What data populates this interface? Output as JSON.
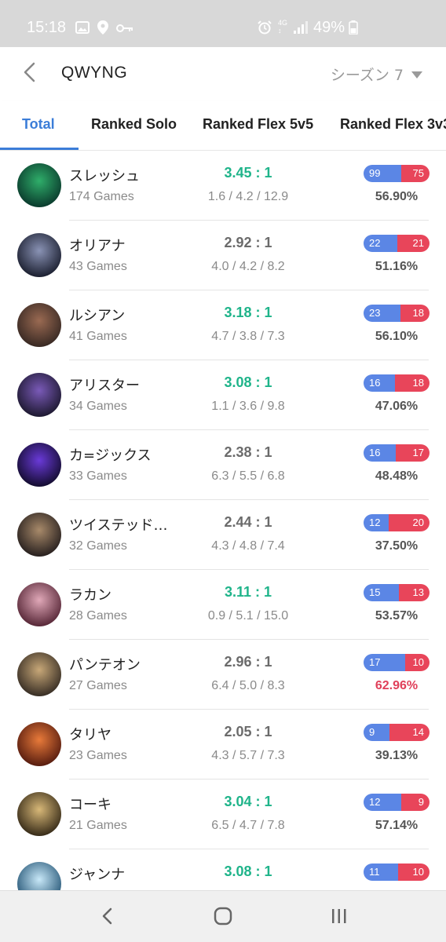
{
  "status_bar": {
    "time": "15:18",
    "battery_percent": "49%",
    "icons_left": [
      "image-icon",
      "location-icon",
      "key-icon"
    ],
    "icons_right": [
      "alarm-icon",
      "4g-signal-icon",
      "signal-icon",
      "battery-icon"
    ]
  },
  "header": {
    "title": "QWYNG",
    "season_label": "シーズン 7"
  },
  "tabs": [
    {
      "label": "Total",
      "active": true
    },
    {
      "label": "Ranked Solo",
      "active": false
    },
    {
      "label": "Ranked Flex 5v5",
      "active": false
    },
    {
      "label": "Ranked Flex 3v3",
      "active": false
    }
  ],
  "colors": {
    "accent": "#3b7dd8",
    "kda_good": "#1fb48a",
    "win": "#5b86e5",
    "loss": "#e8455a",
    "winrate_high": "#e0405a"
  },
  "champions": [
    {
      "name": "スレッシュ",
      "games": "174 Games",
      "kda": "3.45 : 1",
      "kda_good": true,
      "kda_detail": "1.6 / 4.2 / 12.9",
      "wins": "99",
      "losses": "75",
      "winrate": "56.90%",
      "winrate_high": false,
      "avatar_colors": [
        "#0b3d2e",
        "#2fae6a"
      ]
    },
    {
      "name": "オリアナ",
      "games": "43 Games",
      "kda": "2.92 : 1",
      "kda_good": false,
      "kda_detail": "4.0 / 4.2 / 8.2",
      "wins": "22",
      "losses": "21",
      "winrate": "51.16%",
      "winrate_high": false,
      "avatar_colors": [
        "#1e2233",
        "#8a93b5"
      ]
    },
    {
      "name": "ルシアン",
      "games": "41 Games",
      "kda": "3.18 : 1",
      "kda_good": true,
      "kda_detail": "4.7 / 3.8 / 7.3",
      "wins": "23",
      "losses": "18",
      "winrate": "56.10%",
      "winrate_high": false,
      "avatar_colors": [
        "#3a2a24",
        "#9a6a52"
      ]
    },
    {
      "name": "アリスター",
      "games": "34 Games",
      "kda": "3.08 : 1",
      "kda_good": true,
      "kda_detail": "1.1 / 3.6 / 9.8",
      "wins": "16",
      "losses": "18",
      "winrate": "47.06%",
      "winrate_high": false,
      "avatar_colors": [
        "#1f1a33",
        "#7a5ab8"
      ]
    },
    {
      "name": "カ=ジックス",
      "games": "33 Games",
      "kda": "2.38 : 1",
      "kda_good": false,
      "kda_detail": "6.3 / 5.5 / 6.8",
      "wins": "16",
      "losses": "17",
      "winrate": "48.48%",
      "winrate_high": false,
      "avatar_colors": [
        "#150d33",
        "#6a3ad8"
      ]
    },
    {
      "name": "ツイステッド…",
      "games": "32 Games",
      "kda": "2.44 : 1",
      "kda_good": false,
      "kda_detail": "4.3 / 4.8 / 7.4",
      "wins": "12",
      "losses": "20",
      "winrate": "37.50%",
      "winrate_high": false,
      "avatar_colors": [
        "#2a2220",
        "#a88a6a"
      ]
    },
    {
      "name": "ラカン",
      "games": "28 Games",
      "kda": "3.11 : 1",
      "kda_good": true,
      "kda_detail": "0.9 / 5.1 / 15.0",
      "wins": "15",
      "losses": "13",
      "winrate": "53.57%",
      "winrate_high": false,
      "avatar_colors": [
        "#5a2a3a",
        "#e0a8b8"
      ]
    },
    {
      "name": "パンテオン",
      "games": "27 Games",
      "kda": "2.96 : 1",
      "kda_good": false,
      "kda_detail": "6.4 / 5.0 / 8.3",
      "wins": "17",
      "losses": "10",
      "winrate": "62.96%",
      "winrate_high": true,
      "avatar_colors": [
        "#3a3026",
        "#c8a878"
      ]
    },
    {
      "name": "タリヤ",
      "games": "23 Games",
      "kda": "2.05 : 1",
      "kda_good": false,
      "kda_detail": "4.3 / 5.7 / 7.3",
      "wins": "9",
      "losses": "14",
      "winrate": "39.13%",
      "winrate_high": false,
      "avatar_colors": [
        "#5a1e10",
        "#e87a3a"
      ]
    },
    {
      "name": "コーキ",
      "games": "21 Games",
      "kda": "3.04 : 1",
      "kda_good": true,
      "kda_detail": "6.5 / 4.7 / 7.8",
      "wins": "12",
      "losses": "9",
      "winrate": "57.14%",
      "winrate_high": false,
      "avatar_colors": [
        "#3a2e1a",
        "#d8b878"
      ]
    },
    {
      "name": "ジャンナ",
      "games": "",
      "kda": "3.08 : 1",
      "kda_good": true,
      "kda_detail": "",
      "wins": "11",
      "losses": "10",
      "winrate": "",
      "winrate_high": false,
      "avatar_colors": [
        "#2a5a7a",
        "#c8e8f8"
      ]
    }
  ],
  "nav": {
    "buttons": [
      "back-nav",
      "home-nav",
      "recents-nav"
    ]
  }
}
